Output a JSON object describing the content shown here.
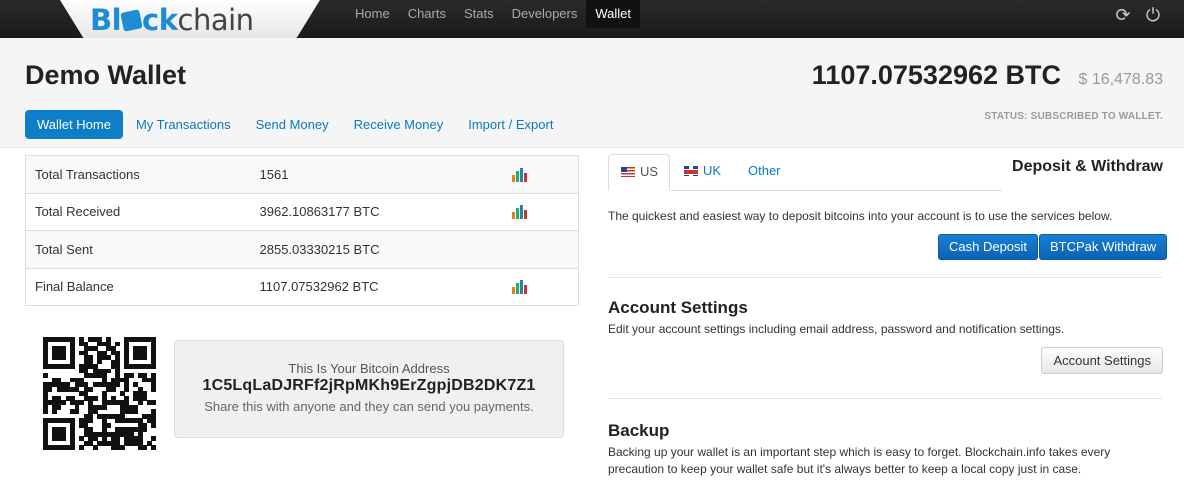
{
  "app": {
    "logo_pre": "Bl",
    "logo_brand": "ck",
    "logo_post": "chain"
  },
  "topnav": {
    "items": [
      "Home",
      "Charts",
      "Stats",
      "Developers",
      "Wallet"
    ],
    "active": "Wallet"
  },
  "header": {
    "title": "Demo Wallet",
    "balance_btc": "1107.07532962 BTC",
    "balance_fiat": "$ 16,478.83",
    "status": "STATUS: SUBSCRIBED TO WALLET."
  },
  "subnav": {
    "items": [
      "Wallet Home",
      "My Transactions",
      "Send Money",
      "Receive Money",
      "Import / Export"
    ],
    "active": "Wallet Home"
  },
  "stats": [
    {
      "label": "Total Transactions",
      "value": "1561",
      "chart_icon": true
    },
    {
      "label": "Total Received",
      "value": "3962.10863177 BTC",
      "chart_icon": true
    },
    {
      "label": "Total Sent",
      "value": "2855.03330215 BTC",
      "chart_icon": false
    },
    {
      "label": "Final Balance",
      "value": "1107.07532962 BTC",
      "chart_icon": true
    }
  ],
  "address": {
    "label": "This Is Your Bitcoin Address",
    "value": "1C5LqLaDJRFf2jRpMKh9ErZgpjDB2DK7Z1",
    "note": "Share this with anyone and they can send you payments."
  },
  "deposit": {
    "tabs": [
      "US",
      "UK",
      "Other"
    ],
    "active_tab": "US",
    "title": "Deposit & Withdraw",
    "text": "The quickest and easiest way to deposit bitcoins into your account is to use the services below.",
    "buttons": [
      "Cash Deposit",
      "BTCPak Withdraw"
    ]
  },
  "account_settings": {
    "title": "Account Settings",
    "text": "Edit your account settings including email address, password and notification settings.",
    "button": "Account Settings"
  },
  "backup": {
    "title": "Backup",
    "text": "Backing up your wallet is an important step which is easy to forget. Blockchain.info takes every precaution to keep your wallet safe but it's always better to keep a local copy just in case."
  },
  "colors": {
    "accent": "#0d7ec7",
    "button_blue": "#0b63b5",
    "navbar": "#1a1a1a"
  },
  "icons": {
    "refresh": "refresh-icon",
    "power": "power-icon",
    "bar_chart": "bar-chart-icon"
  }
}
